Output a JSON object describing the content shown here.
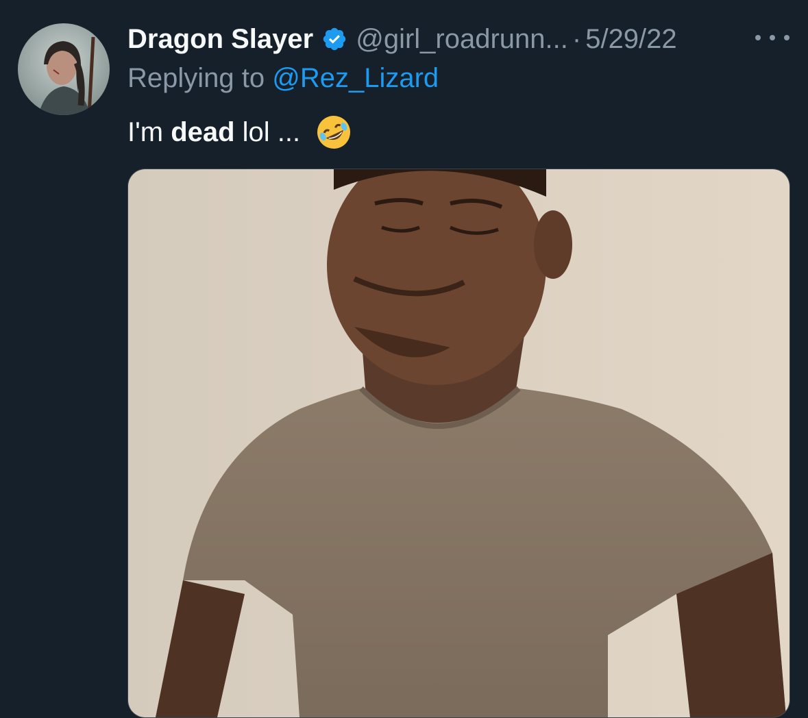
{
  "tweet": {
    "display_name": "Dragon Slayer",
    "handle": "@girl_roadrunn...",
    "separator": "·",
    "date": "5/29/22",
    "replying_prefix": "Replying to ",
    "replying_to": "@Rez_Lizard",
    "text_before": "I'm ",
    "text_bold": "dead",
    "text_after": " lol ...",
    "emoji": "rolling-on-floor-laughing-emoji",
    "verified": true
  },
  "icons": {
    "verified": "verified-badge-icon",
    "more": "more-options-icon"
  },
  "colors": {
    "background": "#15202b",
    "primary_text": "#f7f9f9",
    "secondary_text": "#8b98a5",
    "link": "#1d9bf0"
  }
}
